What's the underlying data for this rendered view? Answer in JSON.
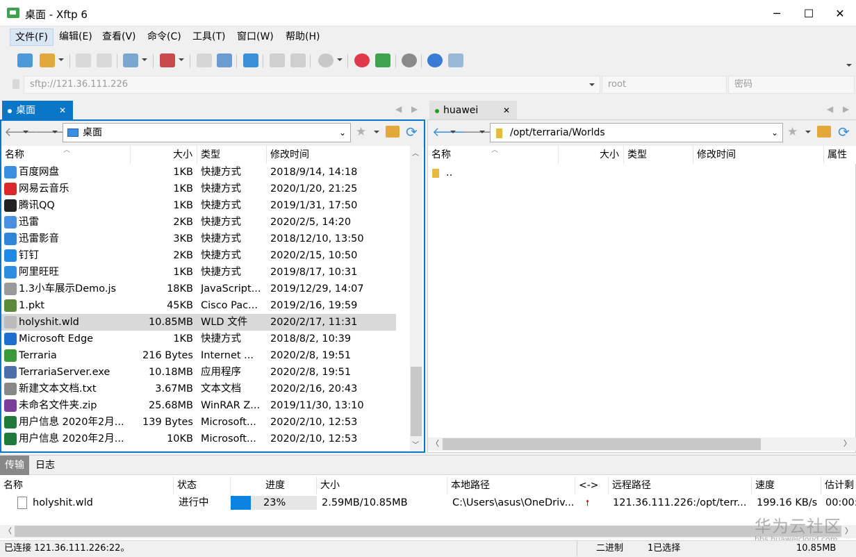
{
  "window": {
    "title": "桌面 - Xftp 6",
    "minimize": "─",
    "maximize": "☐",
    "close": "✕"
  },
  "menu": [
    "文件(F)",
    "编辑(E)",
    "查看(V)",
    "命令(C)",
    "工具(T)",
    "窗口(W)",
    "帮助(H)"
  ],
  "address": {
    "url": "sftp://121.36.111.226",
    "user": "root",
    "password_placeholder": "密码"
  },
  "left": {
    "tab": "桌面",
    "path": "桌面",
    "columns": [
      "名称",
      "大小",
      "类型",
      "修改时间"
    ],
    "files": [
      {
        "name": "百度网盘",
        "size": "1KB",
        "type": "快捷方式",
        "time": "2018/9/14, 14:18",
        "color": "#3b8fe0"
      },
      {
        "name": "网易云音乐",
        "size": "1KB",
        "type": "快捷方式",
        "time": "2020/1/20, 21:25",
        "color": "#d8282a"
      },
      {
        "name": "腾讯QQ",
        "size": "1KB",
        "type": "快捷方式",
        "time": "2019/1/31, 17:50",
        "color": "#222222"
      },
      {
        "name": "迅雷",
        "size": "2KB",
        "type": "快捷方式",
        "time": "2020/2/5, 14:20",
        "color": "#4a90e2"
      },
      {
        "name": "迅雷影音",
        "size": "3KB",
        "type": "快捷方式",
        "time": "2018/12/10, 13:50",
        "color": "#2f86d8"
      },
      {
        "name": "钉钉",
        "size": "2KB",
        "type": "快捷方式",
        "time": "2020/2/15, 10:50",
        "color": "#1e8ae6"
      },
      {
        "name": "阿里旺旺",
        "size": "1KB",
        "type": "快捷方式",
        "time": "2019/8/17, 10:31",
        "color": "#2d8ee0"
      },
      {
        "name": "1.3小车展示Demo.js",
        "size": "18KB",
        "type": "JavaScript...",
        "time": "2019/12/29, 14:07",
        "color": "#999999"
      },
      {
        "name": "1.pkt",
        "size": "45KB",
        "type": "Cisco Pac...",
        "time": "2019/2/16, 19:59",
        "color": "#5a8a3a"
      },
      {
        "name": "holyshit.wld",
        "size": "10.85MB",
        "type": "WLD 文件",
        "time": "2020/2/17, 11:31",
        "color": "#bbbbbb"
      },
      {
        "name": "Microsoft Edge",
        "size": "1KB",
        "type": "快捷方式",
        "time": "2018/8/2, 10:39",
        "color": "#1f6fd0"
      },
      {
        "name": "Terraria",
        "size": "216 Bytes",
        "type": "Internet ...",
        "time": "2020/2/8, 19:51",
        "color": "#3a9a3a"
      },
      {
        "name": "TerrariaServer.exe",
        "size": "10.18MB",
        "type": "应用程序",
        "time": "2020/2/8, 19:51",
        "color": "#4b6fa8"
      },
      {
        "name": "新建文本文档.txt",
        "size": "3.67MB",
        "type": "文本文档",
        "time": "2020/2/16, 20:43",
        "color": "#888888"
      },
      {
        "name": "未命名文件夹.zip",
        "size": "25.68MB",
        "type": "WinRAR Z...",
        "time": "2019/11/30, 13:10",
        "color": "#7a3f9a"
      },
      {
        "name": "用户信息 2020年2月...",
        "size": "139 Bytes",
        "type": "Microsoft...",
        "time": "2020/2/10, 12:53",
        "color": "#1f7a3d"
      },
      {
        "name": "用户信息 2020年2月...",
        "size": "10KB",
        "type": "Microsoft...",
        "time": "2020/2/10, 12:53",
        "color": "#1f7a3d"
      }
    ]
  },
  "right": {
    "tab": "huawei",
    "path": "/opt/terraria/Worlds",
    "columns": [
      "名称",
      "大小",
      "类型",
      "修改时间",
      "属性"
    ],
    "files": [
      {
        "name": ".."
      }
    ]
  },
  "transfer": {
    "tabs": [
      "传输",
      "日志"
    ],
    "columns": [
      "名称",
      "状态",
      "进度",
      "大小",
      "本地路径",
      "<->",
      "远程路径",
      "速度",
      "估计剩"
    ],
    "rows": [
      {
        "name": "holyshit.wld",
        "status": "进行中",
        "progress": 23,
        "progress_label": "23%",
        "size": "2.59MB/10.85MB",
        "local": "C:\\Users\\asus\\OneDriv...",
        "remote": "121.36.111.226:/opt/terr...",
        "speed": "199.16 KB/s",
        "eta": "00:00:"
      }
    ]
  },
  "watermark": {
    "main": "华为云社区",
    "sub": "bbs.huaweicloud.com"
  },
  "status": {
    "left": "已连接 121.36.111.226:22。",
    "mode": "二进制",
    "selection": "1已选择",
    "size": "10.85MB"
  }
}
